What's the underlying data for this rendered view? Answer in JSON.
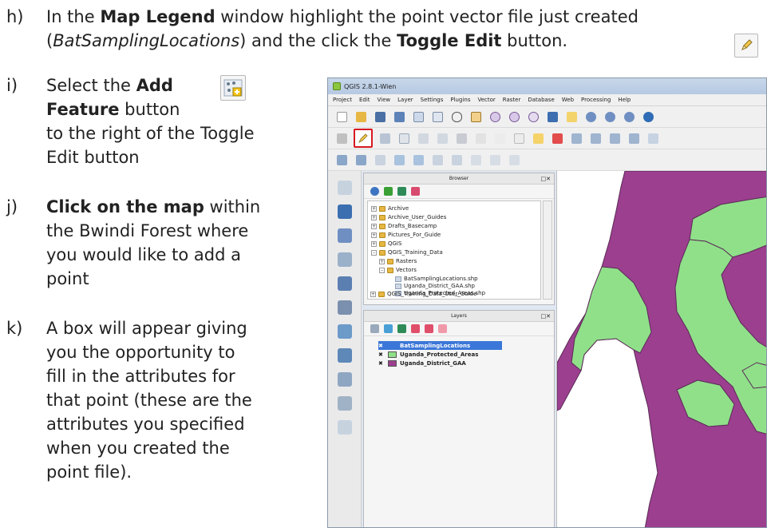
{
  "steps": [
    {
      "marker": "h)",
      "lines": [
        [
          {
            "t": "In the "
          },
          {
            "t": "Map Legend",
            "b": true
          },
          {
            "t": " window highlight the point vector file just created"
          }
        ],
        [
          {
            "t": "("
          },
          {
            "t": "BatSamplingLocations",
            "i": true
          },
          {
            "t": ") and the click the "
          },
          {
            "t": "Toggle Edit",
            "b": true
          },
          {
            "t": " button."
          }
        ]
      ]
    },
    {
      "marker": "i)",
      "lines": [
        [
          {
            "t": "Select the "
          },
          {
            "t": "Add",
            "b": true
          }
        ],
        [
          {
            "t": "Feature",
            "b": true
          },
          {
            "t": " button"
          }
        ],
        [
          {
            "t": "to the right of the Toggle"
          }
        ],
        [
          {
            "t": "Edit button"
          }
        ]
      ]
    },
    {
      "marker": "j)",
      "lines": [
        [
          {
            "t": "Click on the map",
            "b": true
          },
          {
            "t": " within"
          }
        ],
        [
          {
            "t": "the Bwindi Forest where"
          }
        ],
        [
          {
            "t": "you would like to add a"
          }
        ],
        [
          {
            "t": "point"
          }
        ]
      ]
    },
    {
      "marker": "k)",
      "lines": [
        [
          {
            "t": "A box will appear giving"
          }
        ],
        [
          {
            "t": "you the opportunity to"
          }
        ],
        [
          {
            "t": "fill in the attributes for"
          }
        ],
        [
          {
            "t": "that point (these are the"
          }
        ],
        [
          {
            "t": "attributes you specified"
          }
        ],
        [
          {
            "t": "when you created the"
          }
        ],
        [
          {
            "t": "point file)."
          }
        ]
      ]
    }
  ],
  "qgis": {
    "title": "QGIS 2.8.1-Wien",
    "menu": [
      "Project",
      "Edit",
      "View",
      "Layer",
      "Settings",
      "Plugins",
      "Vector",
      "Raster",
      "Database",
      "Web",
      "Processing",
      "Help"
    ],
    "browser": {
      "title": "Browser",
      "items": [
        "Archive",
        "Archive_User_Guides",
        "Drafts_Basecamp",
        "Pictures_For_Guide",
        "QGIS",
        "QGIS_Training_Data",
        "Rasters",
        "Vectors",
        "BatSamplingLocations.shp",
        "Uganda_District_GAA.shp",
        "Uganda_Protected_Areas.shp",
        "QGIS_Training_Data_User_Guide"
      ]
    },
    "layers": {
      "title": "Layers",
      "items": [
        {
          "name": "BatSamplingLocations",
          "color": "#3b77d8"
        },
        {
          "name": "Uganda_Protected_Areas",
          "color": "#90e08a"
        },
        {
          "name": "Uganda_District_GAA",
          "color": "#9c3f8f"
        }
      ]
    },
    "map_colors": {
      "district": "#9c3f8f",
      "protected": "#90e08a",
      "edge": "#5a2a55"
    }
  },
  "icons": {
    "toggle_edit": "pencil-icon",
    "add_feature": "add-feature-icon"
  }
}
